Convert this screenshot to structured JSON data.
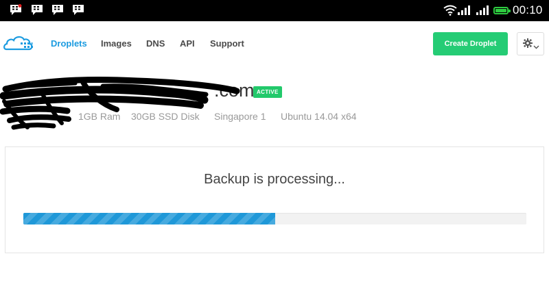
{
  "status_bar": {
    "time": "00:10",
    "notification_icons": [
      "bbm-icon",
      "bbm-icon",
      "bbm-icon",
      "bbm-icon"
    ],
    "wifi": "wifi-icon",
    "signal": [
      "signal-icon",
      "signal-icon"
    ],
    "battery": "battery-icon",
    "battery_color": "#2ecc40"
  },
  "nav": {
    "logo_icon": "cloud-logo-icon",
    "links": [
      "Droplets",
      "Images",
      "DNS",
      "API",
      "Support"
    ],
    "active_link": "Droplets",
    "create_button": "Create Droplet",
    "settings_icon": "gear-icon"
  },
  "droplet": {
    "name_visible_suffix": ".com",
    "status_badge": "ACTIVE",
    "specs": {
      "ram": "1GB Ram",
      "disk": "30GB SSD Disk",
      "region": "Singapore 1",
      "os": "Ubuntu 14.04 x64"
    }
  },
  "backup": {
    "title": "Backup is processing...",
    "progress": 0.5
  },
  "colors": {
    "accent": "#1b9be0",
    "create_button": "#25cc75",
    "badge": "#22c96b",
    "progress_fill": "#1f98d8"
  }
}
